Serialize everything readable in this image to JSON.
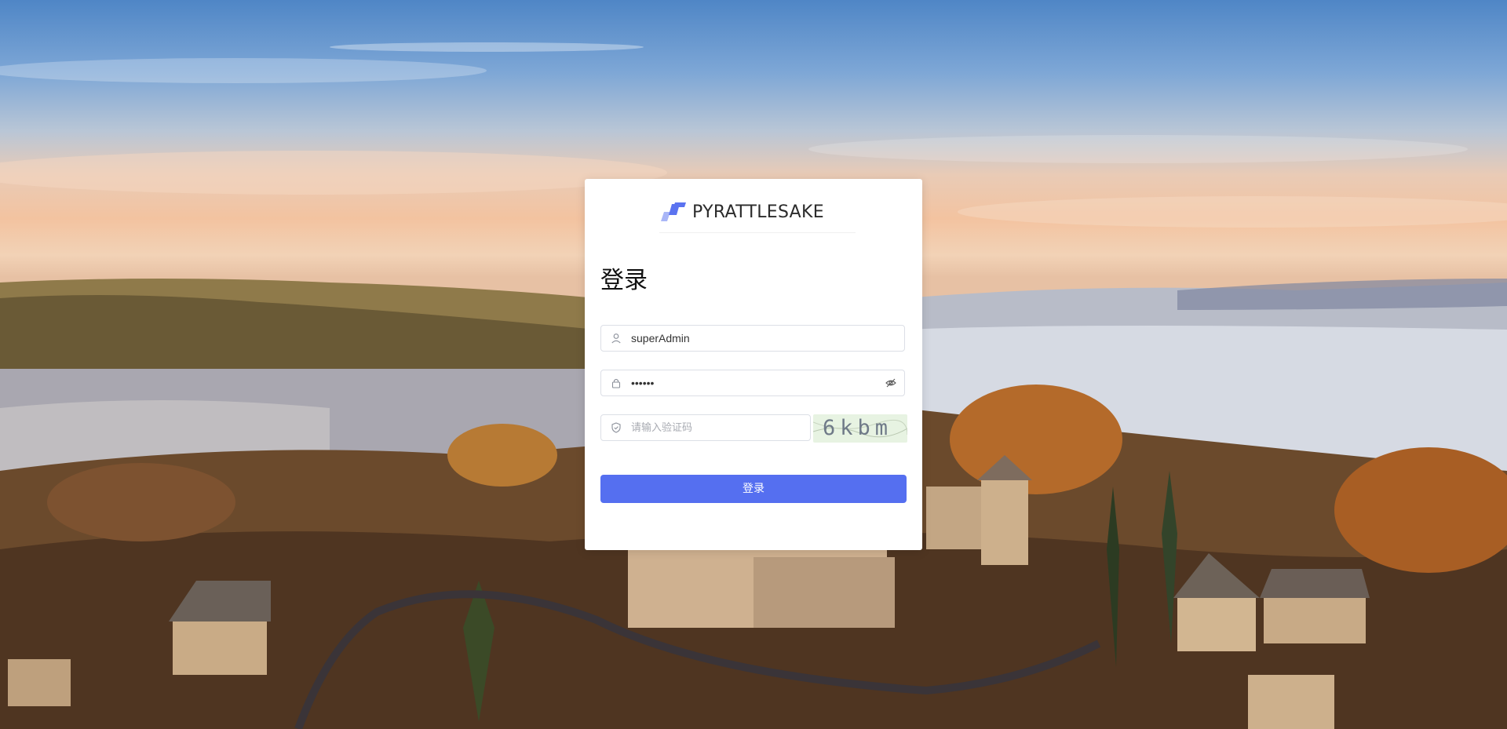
{
  "brand": {
    "name": "PYRATTLESAKE",
    "logo_icon": "brand-logo-icon"
  },
  "login": {
    "title": "登录",
    "username": {
      "value": "superAdmin",
      "icon": "user-icon"
    },
    "password": {
      "value": "••••••",
      "icon": "lock-icon",
      "toggle_icon": "eye-hidden-icon"
    },
    "captcha": {
      "placeholder": "请输入验证码",
      "icon": "shield-icon",
      "image_text": "6kbm"
    },
    "submit_label": "登录"
  },
  "colors": {
    "primary": "#556ff0",
    "logo_accent": "#5b73f0",
    "logo_light": "#a9b6f7"
  }
}
